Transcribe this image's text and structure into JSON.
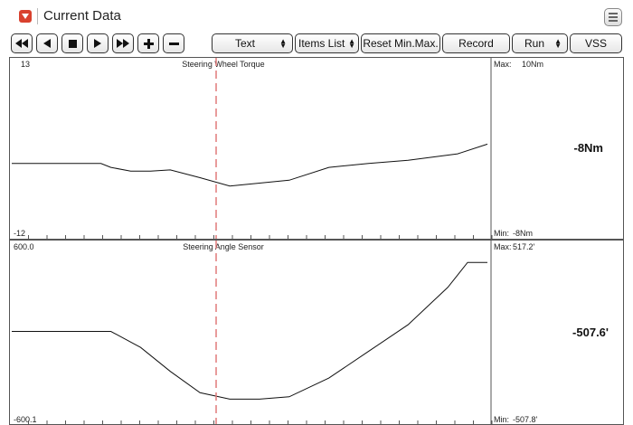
{
  "window": {
    "title": "Current Data"
  },
  "toolbar": {
    "icons": [
      "rewind-icon",
      "step-back-icon",
      "stop-icon",
      "step-forward-icon",
      "fast-forward-icon",
      "zoom-in-icon",
      "zoom-out-icon"
    ],
    "text_label": "Text",
    "items_list_label": "Items List",
    "reset_label": "Reset Min.Max.",
    "record_label": "Record",
    "run_label": "Run",
    "vss_label": "VSS"
  },
  "graph1": {
    "title": "Steering Wheel Torque",
    "y_top": "13",
    "y_bottom": "-12",
    "max_label": "Max:",
    "max_value": "10Nm",
    "min_label": "Min:",
    "min_value": "-8Nm",
    "current_value": "-8Nm"
  },
  "graph2": {
    "title": "Steering Angle Sensor",
    "y_top": "600.0",
    "y_bottom": "-600.1",
    "max_label": "Max:",
    "max_value": "517.2'",
    "min_label": "Min:",
    "min_value": "-507.8'",
    "current_value": "-507.6'"
  },
  "chart_data": [
    {
      "type": "line",
      "title": "Steering Wheel Torque",
      "ylim": [
        -12,
        13
      ],
      "x": [
        0,
        5,
        9,
        10,
        12,
        14,
        16,
        19,
        22,
        28,
        32,
        36,
        40,
        45,
        48
      ],
      "series": [
        {
          "values": [
            -2,
            -2,
            -2,
            -2.6,
            -3.2,
            -3.2,
            -3.0,
            -4.2,
            -5.5,
            -4.6,
            -2.6,
            -2.0,
            -1.5,
            -0.5,
            1.0
          ]
        }
      ]
    },
    {
      "type": "line",
      "title": "Steering Angle Sensor",
      "ylim": [
        -600.1,
        600.0
      ],
      "x": [
        0,
        10,
        13,
        16,
        19,
        22,
        25,
        28,
        32,
        36,
        40,
        44,
        46,
        48
      ],
      "series": [
        {
          "values": [
            0,
            0,
            -120,
            -300,
            -460,
            -507.8,
            -507.8,
            -490,
            -350,
            -150,
            50,
            330,
            517.2,
            517.2
          ]
        }
      ]
    }
  ]
}
